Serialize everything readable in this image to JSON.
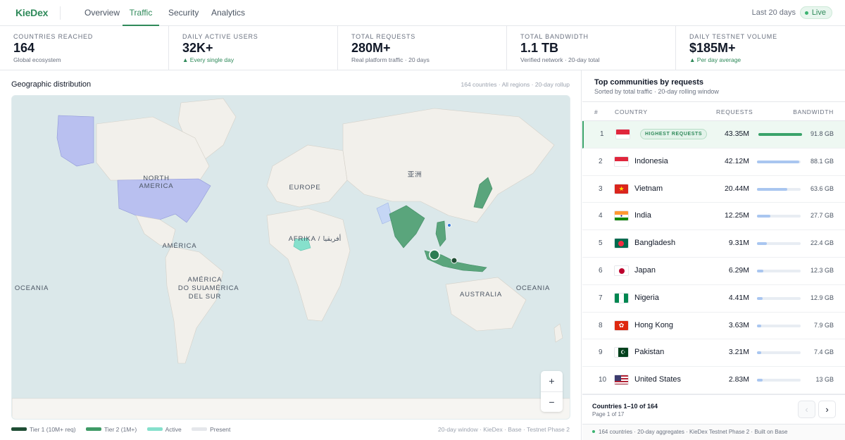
{
  "app": {
    "logo": "KieDex"
  },
  "nav": {
    "tabs": [
      {
        "label": "Overview"
      },
      {
        "label": "Traffic",
        "active": true
      },
      {
        "label": "Security"
      },
      {
        "label": "Analytics"
      }
    ],
    "range": "Last 20 days",
    "live": "Live"
  },
  "kpis": [
    {
      "label": "COUNTRIES REACHED",
      "value": "164",
      "sub": "Global ecosystem",
      "trend": ""
    },
    {
      "label": "DAILY ACTIVE USERS",
      "value": "32K+",
      "sub": "▲ Every single day",
      "trend": "up"
    },
    {
      "label": "TOTAL REQUESTS",
      "value": "280M+",
      "sub": "Real platform traffic · 20 days",
      "trend": ""
    },
    {
      "label": "TOTAL BANDWIDTH",
      "value": "1.1 TB",
      "sub": "Verified network · 20-day total",
      "trend": ""
    },
    {
      "label": "DAILY TESTNET VOLUME",
      "value": "$185M+",
      "sub": "▲ Per day average",
      "trend": "up"
    }
  ],
  "map": {
    "title": "Geographic distribution",
    "meta": "164 countries · All regions · 20-day rollup",
    "labels": {
      "north_america_1": "NORTH",
      "north_america_2": "AMERICA",
      "europe": "EUROPE",
      "asia": "亚洲",
      "africa": "AFRIKA / أفريقيا",
      "america": "AMÉRICA",
      "south_america_1": "AMÉRICA",
      "south_america_2": "DO SUL",
      "south_america_3": "AMÉRICA",
      "south_america_4": "DEL SUR",
      "oceania_left": "OCEANIA",
      "oceania_right": "OCEANIA",
      "australia": "AUSTRALIA"
    },
    "zoom_in": "+",
    "zoom_out": "−",
    "legend": [
      {
        "label": "Tier 1 (10M+ req)",
        "color": "#1f4d34"
      },
      {
        "label": "Tier 2 (1M+)",
        "color": "#3f9a66"
      },
      {
        "label": "Active",
        "color": "#86e0cc"
      },
      {
        "label": "Present",
        "color": "#e5e7eb"
      }
    ],
    "footer": "20-day window · KieDex · Base · Testnet Phase 2",
    "colors": {
      "ocean": "#dbe8ea",
      "land": "#f2f0eb",
      "tier1": "#2e7d52",
      "tier2": "#5aa57c",
      "usa": "#b9c0f0"
    }
  },
  "table": {
    "title": "Top communities by requests",
    "subtitle": "Sorted by total traffic · 20-day rolling window",
    "headers": {
      "rank": "#",
      "country": "COUNTRY",
      "requests": "REQUESTS",
      "bandwidth": "BANDWIDTH"
    },
    "top_badge": "HIGHEST REQUESTS",
    "rows": [
      {
        "rank": "1",
        "country": "",
        "flag": "sg",
        "requests": "43.35M",
        "share": 1.0,
        "bandwidth": "91.8 GB"
      },
      {
        "rank": "2",
        "country": "Indonesia",
        "flag": "id",
        "requests": "42.12M",
        "share": 0.97,
        "bandwidth": "88.1 GB"
      },
      {
        "rank": "3",
        "country": "Vietnam",
        "flag": "vn",
        "requests": "20.44M",
        "share": 0.69,
        "bandwidth": "63.6 GB"
      },
      {
        "rank": "4",
        "country": "India",
        "flag": "in",
        "requests": "12.25M",
        "share": 0.3,
        "bandwidth": "27.7 GB"
      },
      {
        "rank": "5",
        "country": "Bangladesh",
        "flag": "bd",
        "requests": "9.31M",
        "share": 0.23,
        "bandwidth": "22.4 GB"
      },
      {
        "rank": "6",
        "country": "Japan",
        "flag": "jp",
        "requests": "6.29M",
        "share": 0.15,
        "bandwidth": "12.3 GB"
      },
      {
        "rank": "7",
        "country": "Nigeria",
        "flag": "ng",
        "requests": "4.41M",
        "share": 0.13,
        "bandwidth": "12.9 GB"
      },
      {
        "rank": "8",
        "country": "Hong Kong",
        "flag": "hk",
        "requests": "3.63M",
        "share": 0.09,
        "bandwidth": "7.9 GB"
      },
      {
        "rank": "9",
        "country": "Pakistan",
        "flag": "pk",
        "requests": "3.21M",
        "share": 0.09,
        "bandwidth": "7.4 GB"
      },
      {
        "rank": "10",
        "country": "United States",
        "flag": "us",
        "requests": "2.83M",
        "share": 0.13,
        "bandwidth": "13 GB"
      }
    ],
    "bar_colors": {
      "top": "#3aa36a",
      "rest": "#a9c6f0"
    },
    "pager": {
      "range": "Countries 1–10 of 164",
      "page": "Page 1 of 17",
      "prev": "‹",
      "next": "›"
    },
    "footer_note": "164 countries · 20-day aggregates · KieDex Testnet Phase 2 · Built on Base"
  }
}
